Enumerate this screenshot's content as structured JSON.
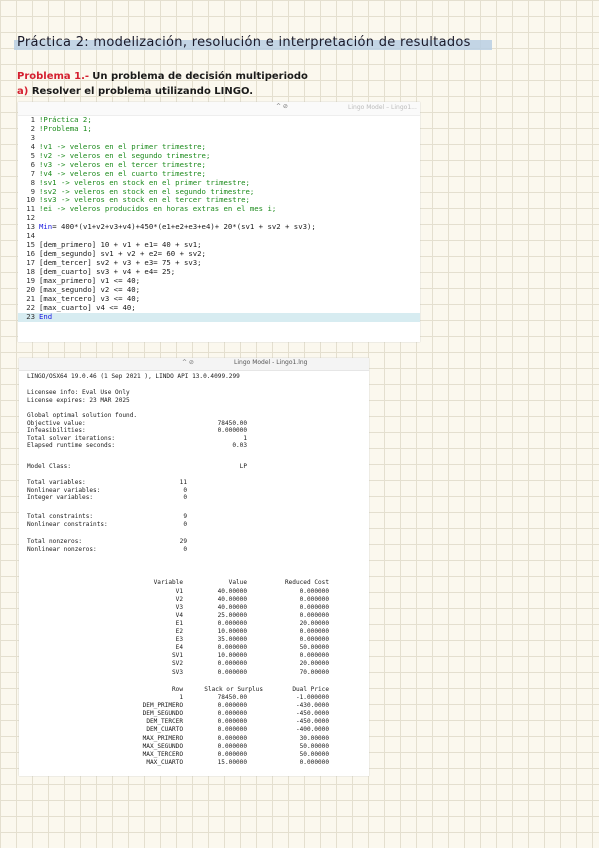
{
  "title": "Práctica 2: modelización, resolución e interpretación de resultados",
  "problem": {
    "label": "Problema 1.-",
    "text": "Un problema de decisión multiperiodo"
  },
  "task": {
    "label": "a)",
    "text": "Resolver el problema utilizando LINGO."
  },
  "code_window": {
    "title_faded": "Lingo Model – Lingo1..."
  },
  "code": [
    {
      "n": "1",
      "t": "!Práctica 2;",
      "type": "comment"
    },
    {
      "n": "2",
      "t": "!Problema 1;",
      "type": "comment"
    },
    {
      "n": "3",
      "t": "",
      "type": "code"
    },
    {
      "n": "4",
      "t": "!v1 -> veleros en el primer trimestre;",
      "type": "comment"
    },
    {
      "n": "5",
      "t": "!v2 -> veleros en el segundo trimestre;",
      "type": "comment"
    },
    {
      "n": "6",
      "t": "!v3 -> veleros en el tercer trimestre;",
      "type": "comment"
    },
    {
      "n": "7",
      "t": "!v4 -> veleros en el cuarto trimestre;",
      "type": "comment"
    },
    {
      "n": "8",
      "t": "!sv1 -> veleros en stock en el primer trimestre;",
      "type": "comment"
    },
    {
      "n": "9",
      "t": "!sv2 -> veleros en stock en el segundo trimestre;",
      "type": "comment"
    },
    {
      "n": "10",
      "t": "!sv3 -> veleros en stock en el tercer trimestre;",
      "type": "comment"
    },
    {
      "n": "11",
      "t": "!ei -> veleros producidos en horas extras en el mes i;",
      "type": "comment"
    },
    {
      "n": "12",
      "t": "",
      "type": "code"
    },
    {
      "n": "13",
      "t": "Min= 400*(v1+v2+v3+v4)+450*(e1+e2+e3+e4)+ 20*(sv1 + sv2 + sv3);",
      "type": "min"
    },
    {
      "n": "14",
      "t": "",
      "type": "code"
    },
    {
      "n": "15",
      "t": "[dem_primero] 10 + v1 + e1= 40 + sv1;",
      "type": "code"
    },
    {
      "n": "16",
      "t": "[dem_segundo] sv1 + v2 + e2= 60 + sv2;",
      "type": "code"
    },
    {
      "n": "17",
      "t": "[dem_tercer] sv2 + v3 + e3= 75 + sv3;",
      "type": "code"
    },
    {
      "n": "18",
      "t": "[dem_cuarto] sv3 + v4 + e4= 25;",
      "type": "code"
    },
    {
      "n": "19",
      "t": "[max_primero] v1 <= 40;",
      "type": "code"
    },
    {
      "n": "20",
      "t": "[max_segundo] v2 <= 40;",
      "type": "code"
    },
    {
      "n": "21",
      "t": "[max_tercero] v3 <= 40;",
      "type": "code"
    },
    {
      "n": "22",
      "t": "[max_cuarto] v4 <= 40;",
      "type": "code"
    },
    {
      "n": "23",
      "t": "End",
      "type": "end"
    }
  ],
  "output_window": {
    "title": "Lingo Model - Lingo1.lng",
    "header1": "LINGO/OSX64 19.0.46 (1 Sep 2021 ), LINDO API 13.0.4099.299",
    "licensee": "Licensee info: Eval Use Only",
    "expires": "License expires: 23 MAR 2025",
    "global": "Global optimal solution found.",
    "summary": [
      {
        "k": "Objective value:",
        "v": "78450.00"
      },
      {
        "k": "Infeasibilities:",
        "v": "0.000000"
      },
      {
        "k": "Total solver iterations:",
        "v": "1"
      },
      {
        "k": "Elapsed runtime seconds:",
        "v": "0.03"
      }
    ],
    "model_class_label": "Model Class:",
    "model_class": "LP",
    "var_counts": [
      {
        "k": "Total variables:",
        "v": "11"
      },
      {
        "k": "Nonlinear variables:",
        "v": "0"
      },
      {
        "k": "Integer variables:",
        "v": "0"
      }
    ],
    "con_counts": [
      {
        "k": "Total constraints:",
        "v": "9"
      },
      {
        "k": "Nonlinear constraints:",
        "v": "0"
      }
    ],
    "nz_counts": [
      {
        "k": "Total nonzeros:",
        "v": "29"
      },
      {
        "k": "Nonlinear nonzeros:",
        "v": "0"
      }
    ],
    "var_headers": [
      "Variable",
      "Value",
      "Reduced Cost"
    ],
    "variables": [
      [
        "V1",
        "40.00000",
        "0.000000"
      ],
      [
        "V2",
        "40.00000",
        "0.000000"
      ],
      [
        "V3",
        "40.00000",
        "0.000000"
      ],
      [
        "V4",
        "25.00000",
        "0.000000"
      ],
      [
        "E1",
        "0.000000",
        "20.00000"
      ],
      [
        "E2",
        "10.00000",
        "0.000000"
      ],
      [
        "E3",
        "35.00000",
        "0.000000"
      ],
      [
        "E4",
        "0.000000",
        "50.00000"
      ],
      [
        "SV1",
        "10.00000",
        "0.000000"
      ],
      [
        "SV2",
        "0.000000",
        "20.00000"
      ],
      [
        "SV3",
        "0.000000",
        "70.00000"
      ]
    ],
    "row_headers": [
      "Row",
      "Slack or Surplus",
      "Dual Price"
    ],
    "rows": [
      [
        "1",
        "78450.00",
        "-1.000000"
      ],
      [
        "DEM_PRIMERO",
        "0.000000",
        "-430.0000"
      ],
      [
        "DEM_SEGUNDO",
        "0.000000",
        "-450.0000"
      ],
      [
        "DEM_TERCER",
        "0.000000",
        "-450.0000"
      ],
      [
        "DEM_CUARTO",
        "0.000000",
        "-400.0000"
      ],
      [
        "MAX_PRIMERO",
        "0.000000",
        "30.00000"
      ],
      [
        "MAX_SEGUNDO",
        "0.000000",
        "50.00000"
      ],
      [
        "MAX_TERCERO",
        "0.000000",
        "50.00000"
      ],
      [
        "MAX_CUARTO",
        "15.00000",
        "0.000000"
      ]
    ]
  }
}
